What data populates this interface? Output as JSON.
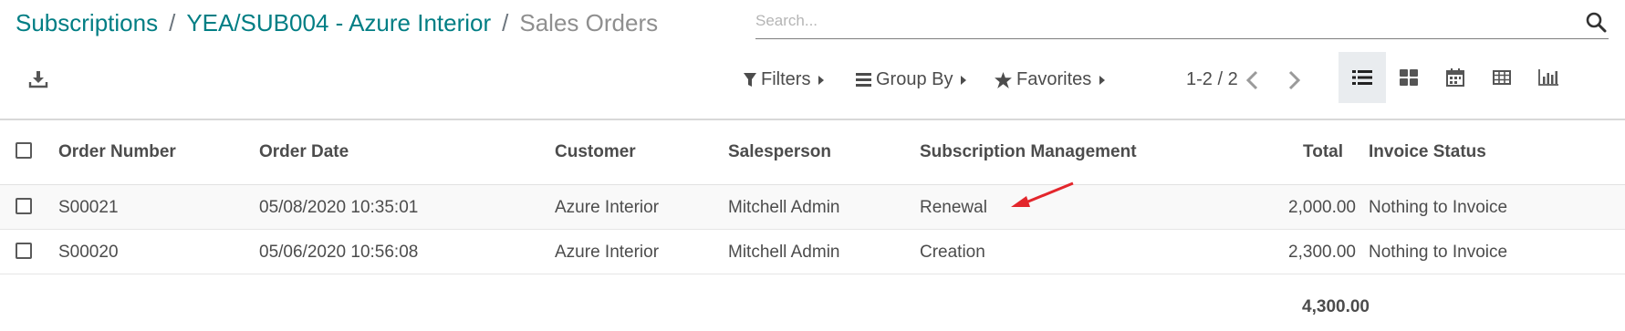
{
  "breadcrumb": {
    "items": [
      "Subscriptions",
      "YEA/SUB004 - Azure Interior"
    ],
    "separator": "/",
    "current": "Sales Orders"
  },
  "search": {
    "placeholder": "Search...",
    "value": ""
  },
  "search_options": {
    "filters": "Filters",
    "group_by": "Group By",
    "favorites": "Favorites"
  },
  "pager": {
    "value": "1-2 / 2"
  },
  "views": [
    "list",
    "kanban",
    "calendar",
    "pivot",
    "graph"
  ],
  "active_view": "list",
  "table": {
    "columns": [
      "Order Number",
      "Order Date",
      "Customer",
      "Salesperson",
      "Subscription Management",
      "Total",
      "Invoice Status"
    ],
    "rows": [
      [
        "S00021",
        "05/08/2020 10:35:01",
        "Azure Interior",
        "Mitchell Admin",
        "Renewal",
        "2,000.00",
        "Nothing to Invoice"
      ],
      [
        "S00020",
        "05/06/2020 10:56:08",
        "Azure Interior",
        "Mitchell Admin",
        "Creation",
        "2,300.00",
        "Nothing to Invoice"
      ]
    ],
    "total": "4,300.00"
  },
  "colors": {
    "brand": "#017e84",
    "annotation_arrow": "#e3262c"
  },
  "icons": [
    "search-icon",
    "download-icon",
    "filter-icon",
    "group-by-icon",
    "star-icon",
    "chevron-left-icon",
    "chevron-right-icon",
    "list-view-icon",
    "kanban-view-icon",
    "calendar-view-icon",
    "pivot-view-icon",
    "graph-view-icon"
  ]
}
